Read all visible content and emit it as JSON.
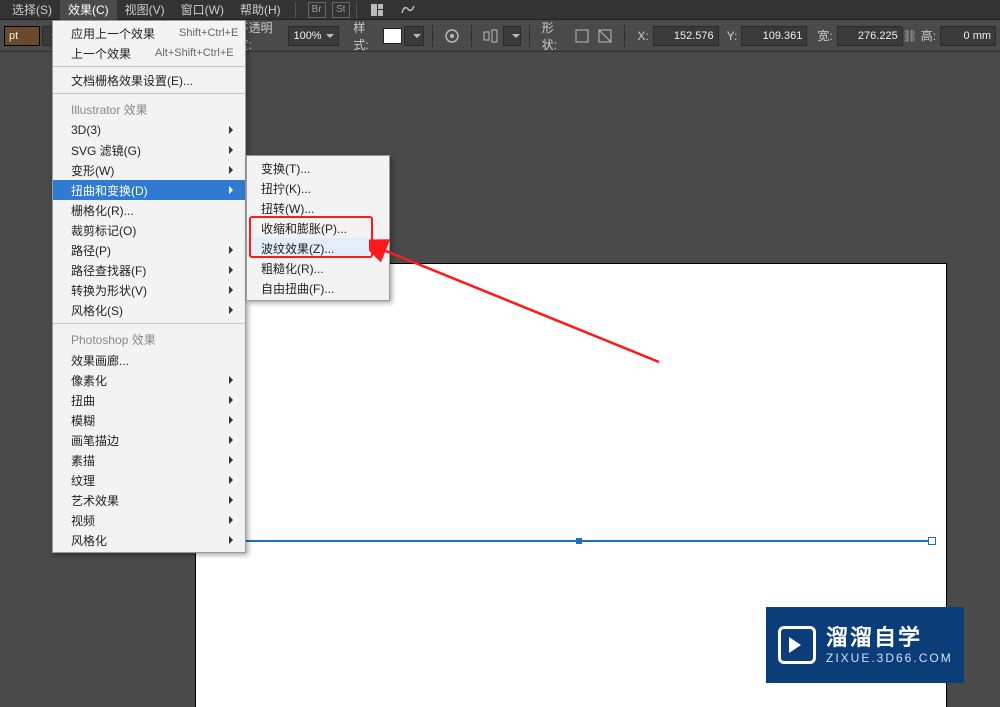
{
  "menubar": {
    "items": [
      {
        "label": "选择(S)"
      },
      {
        "label": "效果(C)"
      },
      {
        "label": "视图(V)"
      },
      {
        "label": "窗口(W)"
      },
      {
        "label": "帮助(H)"
      }
    ],
    "tool_icons": [
      "Br",
      "St"
    ]
  },
  "optbar": {
    "left_tag": "pt",
    "opacity_label": "不透明度:",
    "opacity_value": "100%",
    "style_label": "样式:",
    "shape_label": "形状:",
    "x_label": "X:",
    "x_value": "152.576",
    "y_label": "Y:",
    "y_value": "109.361",
    "w_label": "宽:",
    "w_value": "276.225",
    "h_label": "高:",
    "h_value": "0 mm"
  },
  "effects_menu": {
    "apply_last": "应用上一个效果",
    "apply_last_sc": "Shift+Ctrl+E",
    "last": "上一个效果",
    "last_sc": "Alt+Shift+Ctrl+E",
    "doc_raster": "文档栅格效果设置(E)...",
    "ill_header": "Illustrator 效果",
    "ill_items": [
      {
        "label": "3D(3)",
        "sub": true
      },
      {
        "label": "SVG 滤镜(G)",
        "sub": true
      },
      {
        "label": "变形(W)",
        "sub": true
      },
      {
        "label": "扭曲和变换(D)",
        "sub": true,
        "hl": true
      },
      {
        "label": "栅格化(R)...",
        "sub": false
      },
      {
        "label": "裁剪标记(O)",
        "sub": false
      },
      {
        "label": "路径(P)",
        "sub": true
      },
      {
        "label": "路径查找器(F)",
        "sub": true
      },
      {
        "label": "转换为形状(V)",
        "sub": true
      },
      {
        "label": "风格化(S)",
        "sub": true
      }
    ],
    "ps_header": "Photoshop 效果",
    "ps_items": [
      {
        "label": "效果画廊...",
        "sub": false
      },
      {
        "label": "像素化",
        "sub": true
      },
      {
        "label": "扭曲",
        "sub": true
      },
      {
        "label": "模糊",
        "sub": true
      },
      {
        "label": "画笔描边",
        "sub": true
      },
      {
        "label": "素描",
        "sub": true
      },
      {
        "label": "纹理",
        "sub": true
      },
      {
        "label": "艺术效果",
        "sub": true
      },
      {
        "label": "视频",
        "sub": true
      },
      {
        "label": "风格化",
        "sub": true
      }
    ]
  },
  "distort_submenu": {
    "items": [
      {
        "label": "变换(T)..."
      },
      {
        "label": "扭拧(K)..."
      },
      {
        "label": "扭转(W)..."
      },
      {
        "label": "收缩和膨胀(P)..."
      },
      {
        "label": "波纹效果(Z)...",
        "hover": true
      },
      {
        "label": "粗糙化(R)..."
      },
      {
        "label": "自由扭曲(F)..."
      }
    ]
  },
  "watermark": {
    "title": "溜溜自学",
    "sub": "ZIXUE.3D66.COM"
  }
}
